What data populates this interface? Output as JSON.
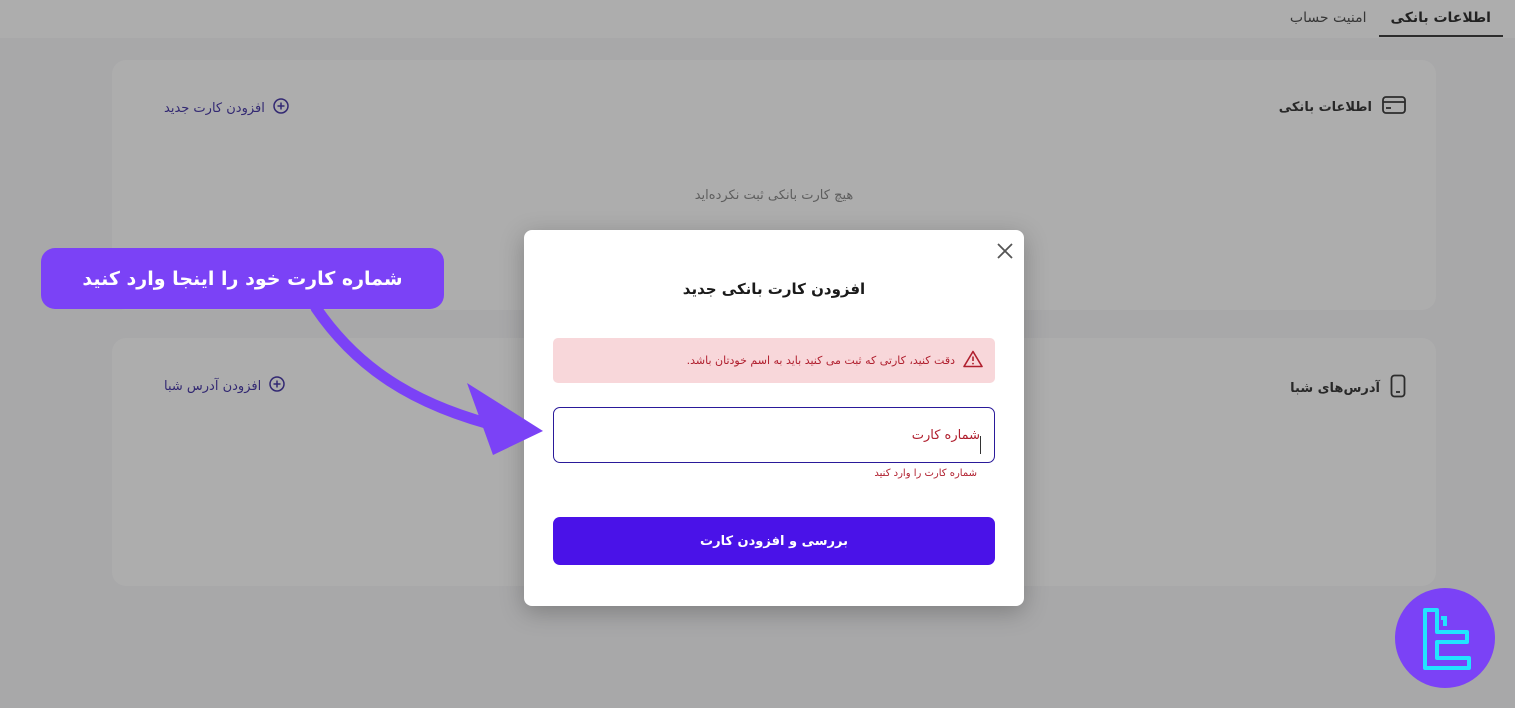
{
  "tabs": [
    {
      "label": "اطلاعات بانکی",
      "active": true
    },
    {
      "label": "امنیت حساب",
      "active": false
    }
  ],
  "bank_section": {
    "title": "اطلاعات بانکی",
    "action": "افزودن کارت جدید",
    "empty_text": "هیچ کارت بانکی ثبت نکرده‌اید",
    "icon": "credit-card-icon"
  },
  "sheba_section": {
    "title": "آدرس‌های شبا",
    "action": "افزودن آدرس شبا",
    "icon": "mobile-icon"
  },
  "modal": {
    "title": "افزودن کارت بانکی جدید",
    "alert_text": "دقت کنید، کارتی که ثبت می کنید باید به اسم خودتان باشد.",
    "card_input_placeholder": "شماره کارت",
    "error_text": "شماره کارت را وارد کنید",
    "submit_label": "بررسی و افزودن کارت"
  },
  "callout": {
    "text": "شماره کارت خود را اینجا وارد کنید"
  },
  "colors": {
    "primary": "#4a12e8",
    "callout": "#7b42f6",
    "error": "#b01f2e",
    "alert_bg": "#f8d7da",
    "logo_accent": "#22e4ff"
  }
}
